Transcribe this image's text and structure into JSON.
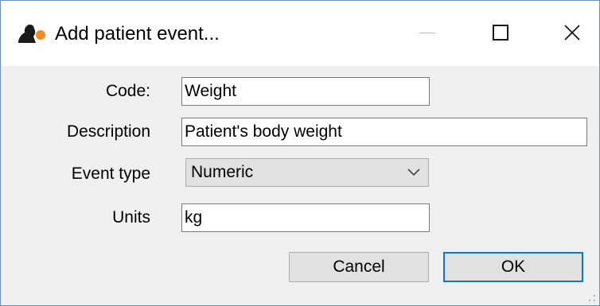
{
  "window": {
    "title": "Add patient event...",
    "icon": "app-logo-icon",
    "controls": {
      "minimize_icon": "minimize-icon",
      "maximize_icon": "maximize-icon",
      "close_icon": "close-icon"
    }
  },
  "form": {
    "code_label": "Code:",
    "code_value": "Weight",
    "description_label": "Description",
    "description_value": "Patient's body weight",
    "event_type_label": "Event type",
    "event_type_value": "Numeric",
    "units_label": "Units",
    "units_value": "kg"
  },
  "buttons": {
    "cancel_label": "Cancel",
    "ok_label": "OK"
  },
  "colors": {
    "focus_border": "#0078d7",
    "title_bar": "#ffffff",
    "dialog_background": "#f0f0f0"
  }
}
